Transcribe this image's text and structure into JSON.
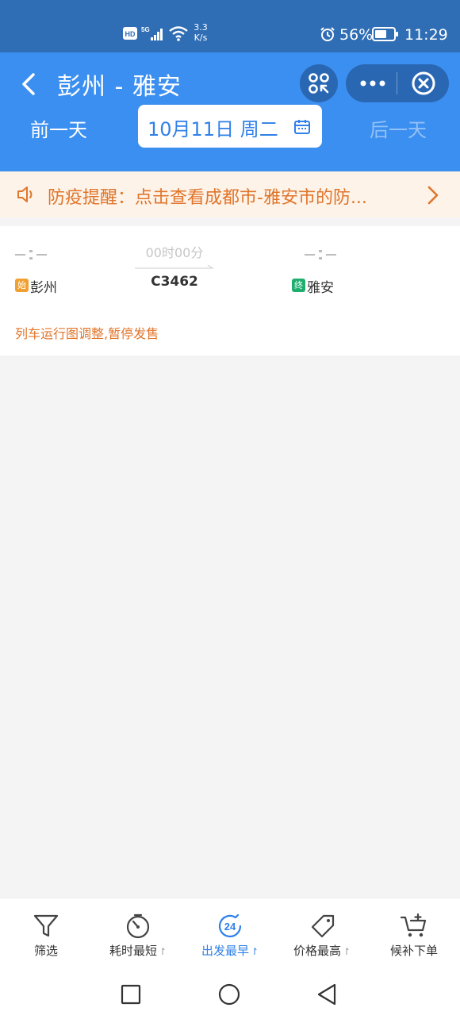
{
  "status_bar": {
    "net_speed_value": "3.3",
    "net_speed_unit": "K/s",
    "battery": "56%",
    "time": "11:29",
    "icons": [
      "hd-icon",
      "signal-5g-icon",
      "wifi-icon",
      "alarm-icon",
      "battery-icon"
    ]
  },
  "header": {
    "title": "彭州 - 雅安",
    "prev_day": "前一天",
    "date": "10月11日 周二",
    "next_day": "后一天"
  },
  "notice": {
    "text": "防疫提醒：点击查看成都市-雅安市的防..."
  },
  "train": {
    "depart_time": "--:--",
    "arrive_time": "--:--",
    "duration": "00时00分",
    "number": "C3462",
    "from_badge": "始",
    "from_station": "彭州",
    "to_badge": "终",
    "to_station": "雅安",
    "status": "列车运行图调整,暂停发售"
  },
  "tabs": [
    {
      "label": "筛选",
      "icon": "filter-icon",
      "sortable": false,
      "active": false
    },
    {
      "label": "耗时最短",
      "icon": "timer-icon",
      "sortable": true,
      "active": false
    },
    {
      "label": "出发最早",
      "icon": "clock-24-icon",
      "badge": "24",
      "sortable": true,
      "active": true
    },
    {
      "label": "价格最高",
      "icon": "price-tag-icon",
      "sortable": true,
      "active": false
    },
    {
      "label": "候补下单",
      "icon": "cart-icon",
      "sortable": false,
      "active": false
    }
  ],
  "colors": {
    "status_bar": "#2f6db5",
    "header": "#3b8ff0",
    "accent_orange": "#e0752b",
    "active_blue": "#2f80e8"
  }
}
